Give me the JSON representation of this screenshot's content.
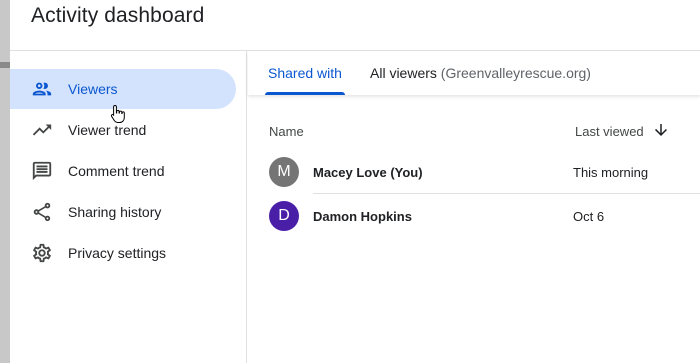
{
  "dialog": {
    "title": "Activity dashboard"
  },
  "sidebar": {
    "items": [
      {
        "label": "Viewers",
        "icon": "people-icon",
        "active": true
      },
      {
        "label": "Viewer trend",
        "icon": "trending-up-icon",
        "active": false
      },
      {
        "label": "Comment trend",
        "icon": "comment-icon",
        "active": false
      },
      {
        "label": "Sharing history",
        "icon": "share-icon",
        "active": false
      },
      {
        "label": "Privacy settings",
        "icon": "gear-icon",
        "active": false
      }
    ]
  },
  "tabs": {
    "shared_with": "Shared with",
    "all_viewers_label": "All viewers",
    "all_viewers_domain": "(Greenvalleyrescue.org)"
  },
  "table": {
    "columns": {
      "name": "Name",
      "last_viewed": "Last viewed"
    },
    "rows": [
      {
        "initial": "M",
        "name": "Macey Love (You)",
        "last_viewed": "This morning",
        "avatar_color": "#757575"
      },
      {
        "initial": "D",
        "name": "Damon Hopkins",
        "last_viewed": "Oct 6",
        "avatar_color": "#4a1fa8"
      }
    ]
  },
  "colors": {
    "accent": "#0b57d0",
    "active_bg": "#d3e3fd"
  }
}
